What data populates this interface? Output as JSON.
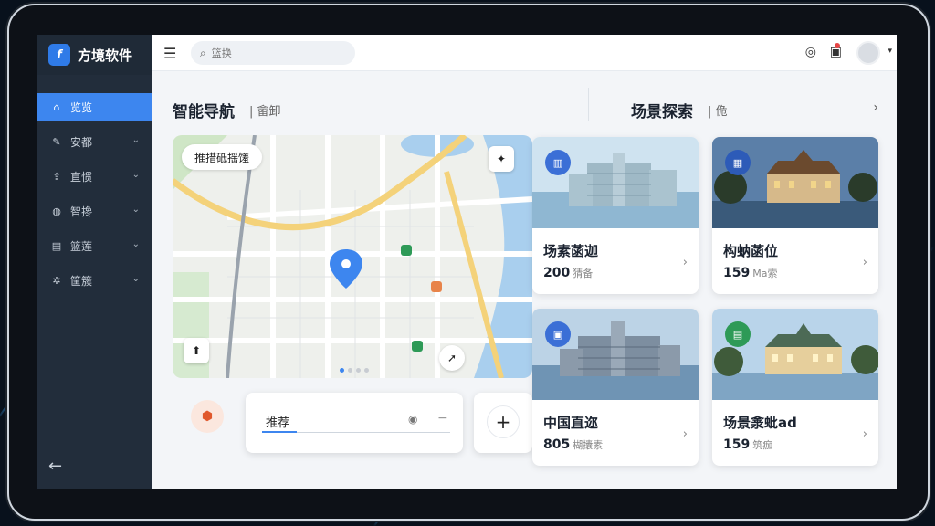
{
  "app": {
    "title": "方境软件",
    "logo_glyph": "f"
  },
  "sidebar": {
    "items": [
      {
        "label": "览览",
        "icon": "home-icon",
        "glyph": "⌂",
        "active": true,
        "has_chevron": false
      },
      {
        "label": "安都",
        "icon": "edit-icon",
        "glyph": "✎",
        "active": false,
        "has_chevron": true
      },
      {
        "label": "直惯",
        "icon": "upload-icon",
        "glyph": "⇪",
        "active": false,
        "has_chevron": true
      },
      {
        "label": "智搀",
        "icon": "globe-icon",
        "glyph": "◍",
        "active": false,
        "has_chevron": true
      },
      {
        "label": "篮莲",
        "icon": "chart-icon",
        "glyph": "▤",
        "active": false,
        "has_chevron": true
      },
      {
        "label": "筐簇",
        "icon": "settings-icon",
        "glyph": "✲",
        "active": false,
        "has_chevron": true
      }
    ],
    "collapse_glyph": "←"
  },
  "topbar": {
    "search_placeholder": "篮换",
    "icons": [
      "target-icon",
      "bag-icon",
      "bell-icon"
    ]
  },
  "nav_section": {
    "title": "智能导航",
    "subtitle": "| 畲卸"
  },
  "scene_section": {
    "title": "场景探索",
    "subtitle": "| 佹"
  },
  "map": {
    "chip_label": "推措砥揺馐",
    "page_dots": 4,
    "active_dot": 0
  },
  "recommend": {
    "label": "推荐"
  },
  "cards": [
    {
      "title": "场素菡迦",
      "count": "200",
      "unit": "猜备",
      "badge_color": "#3b6fd6",
      "scene": "glass"
    },
    {
      "title": "构蚋菡位",
      "count": "159",
      "unit": "Ma索",
      "badge_color": "#2d5bb8",
      "scene": "villa"
    },
    {
      "title": "中国直迩",
      "count": "805",
      "unit": "楜攮素",
      "badge_color": "#3b6fd6",
      "scene": "glass"
    },
    {
      "title": "场景淾蚍ad",
      "count": "159",
      "unit": "筑痂",
      "badge_color": "#2e9a57",
      "scene": "villa"
    }
  ],
  "colors": {
    "accent": "#3d86ef",
    "sidebar": "#222d3b",
    "page": "#f3f5f8"
  }
}
